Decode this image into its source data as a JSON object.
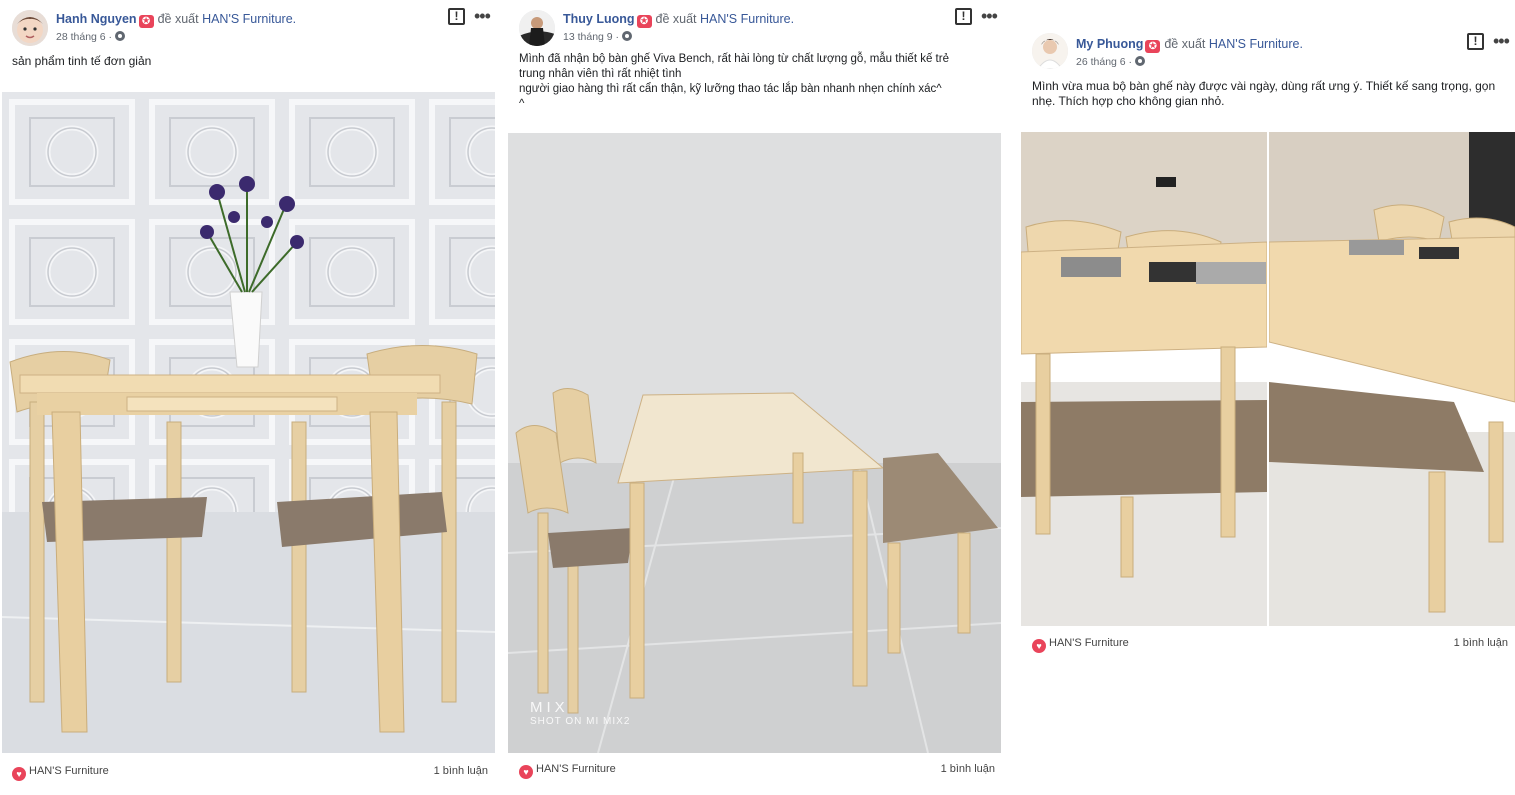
{
  "posts": [
    {
      "author": "Hanh Nguyen",
      "verb": "đề xuất",
      "page": "HAN'S Furniture.",
      "date": "28 tháng 6 ·",
      "text": "sản phẩm tinh tế đơn giản",
      "footer_page": "HAN'S Furniture",
      "comments": "1 bình luận"
    },
    {
      "author": "Thuy Luong",
      "verb": "đề xuất",
      "page": "HAN'S Furniture.",
      "date": "13 tháng 9 ·",
      "text_lines": [
        "Mình đã nhận bộ bàn ghế Viva Bench, rất hài lòng từ chất lượng gỗ, mẫu thiết kế trẻ",
        "trung nhân viên thì rất nhiệt tình",
        "người giao hàng thì rất cẩn thận, kỹ lưỡng thao tác lắp bàn nhanh nhẹn chính xác^",
        "^"
      ],
      "watermark_top": "MIX",
      "watermark_bottom": "SHOT ON MI MIX2",
      "footer_page": "HAN'S Furniture",
      "comments": "1 bình luận"
    },
    {
      "author": "My Phuong",
      "verb": "đề xuất",
      "page": "HAN'S Furniture.",
      "date": "26 tháng 6 ·",
      "text": "Mình vừa mua bộ bàn ghế này được vài ngày, dùng rất ưng ý. Thiết kế sang trọng, gọn nhẹ. Thích hợp cho không gian nhỏ.",
      "footer_page": "HAN'S Furniture",
      "comments": "1 bình luận"
    }
  ],
  "icons": {
    "badge": "recommend-badge-icon",
    "report": "report-icon",
    "more": "more-options-icon",
    "privacy": "globe-icon",
    "reaction": "heart-icon"
  },
  "colors": {
    "link": "#385898",
    "meta": "#616770",
    "reaction": "#e9445a"
  }
}
